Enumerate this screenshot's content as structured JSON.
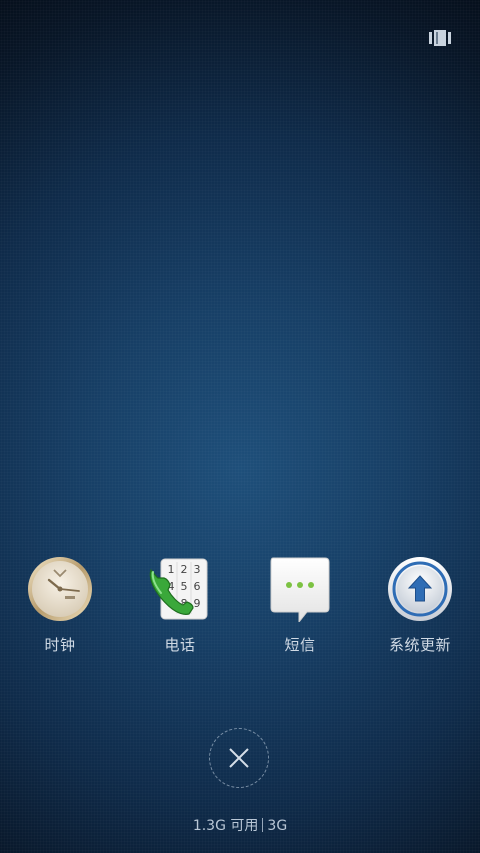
{
  "apps": [
    {
      "label": "时钟",
      "icon": "clock-icon"
    },
    {
      "label": "电话",
      "icon": "phone-icon"
    },
    {
      "label": "短信",
      "icon": "messages-icon"
    },
    {
      "label": "系统更新",
      "icon": "system-update-icon"
    }
  ],
  "memory": {
    "available": "1.3G 可用",
    "total": "3G"
  },
  "colors": {
    "background_center": "#1e4f7a",
    "background_edge": "#050d18",
    "label_text": "#cfd9e4",
    "update_arrow": "#2f6db5",
    "phone_green": "#3aa83a"
  },
  "icons": {
    "recents_toggle": "view-toggle-icon",
    "close_all": "close-icon"
  }
}
